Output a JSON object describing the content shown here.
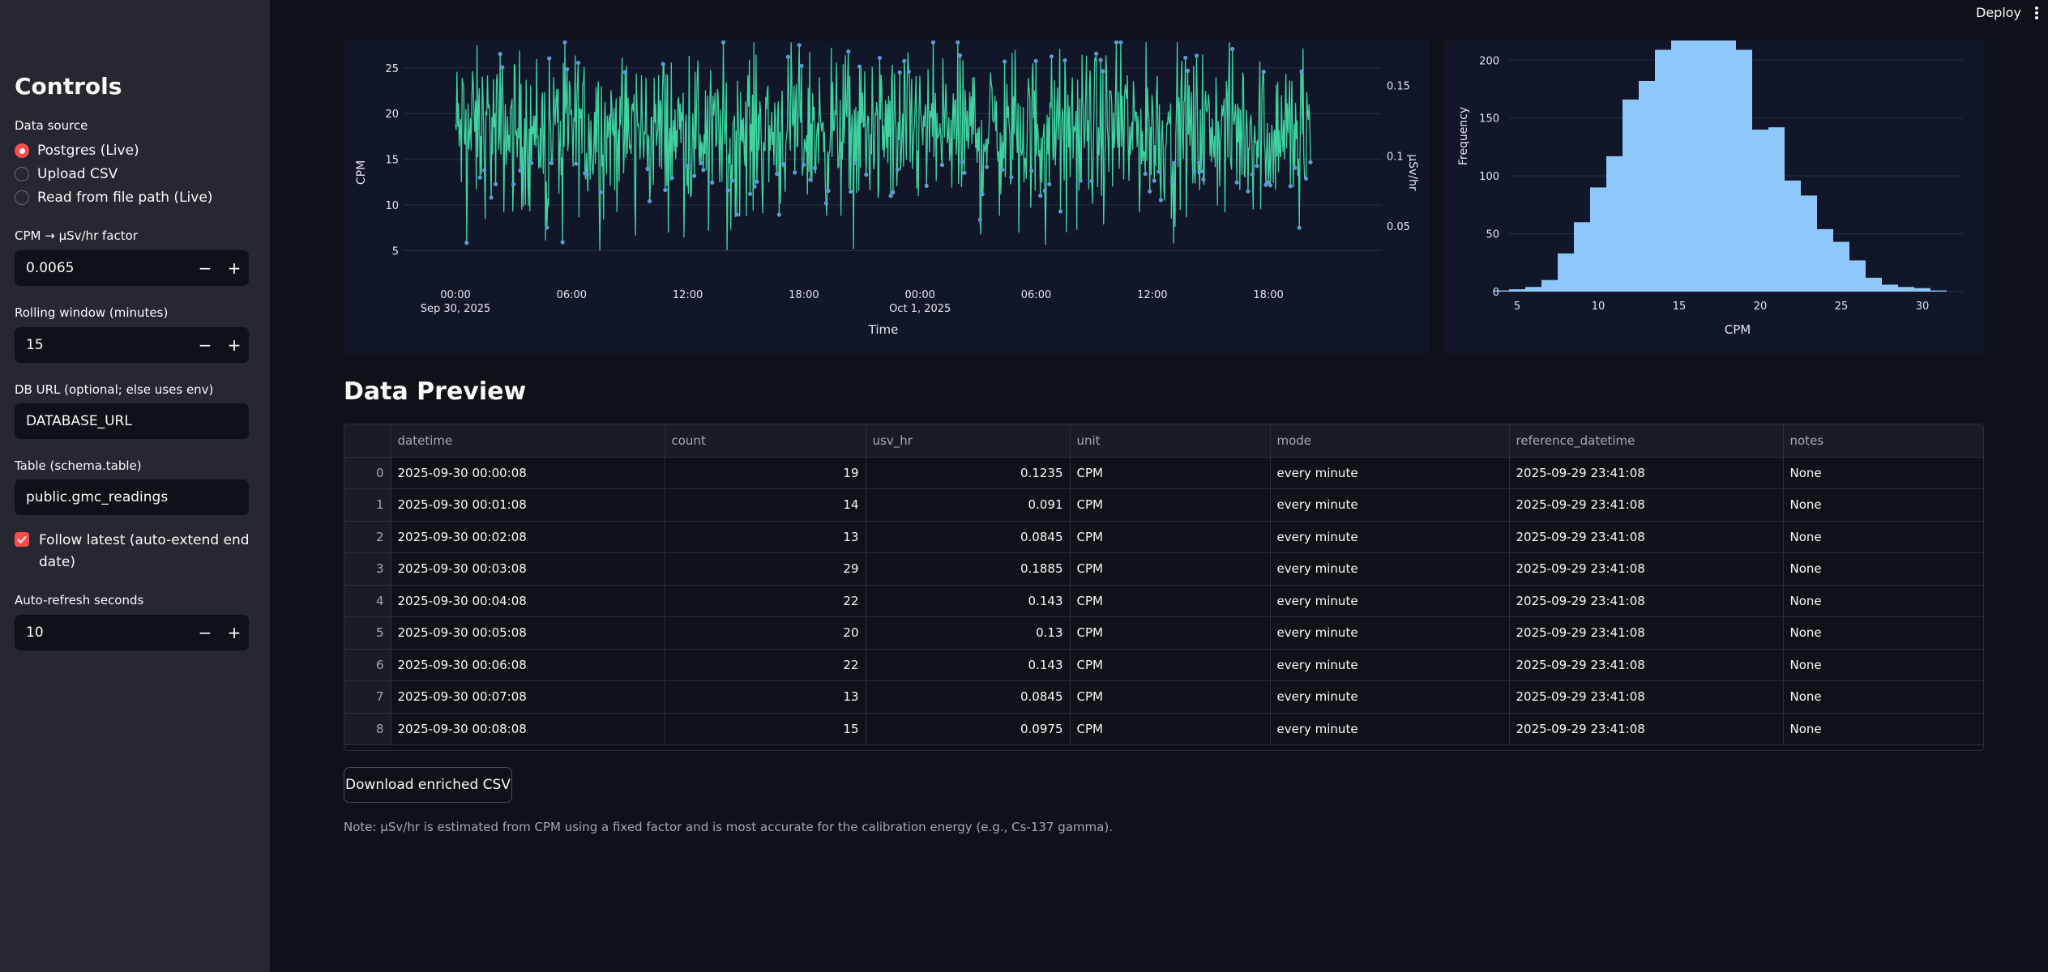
{
  "topbar": {
    "deploy_label": "Deploy"
  },
  "sidebar": {
    "title": "Controls",
    "data_source": {
      "label": "Data source",
      "options": [
        "Postgres (Live)",
        "Upload CSV",
        "Read from file path (Live)"
      ],
      "selected": "Postgres (Live)"
    },
    "factor": {
      "label": "CPM → µSv/hr factor",
      "value": "0.0065"
    },
    "rolling": {
      "label": "Rolling window (minutes)",
      "value": "15"
    },
    "db_url": {
      "label": "DB URL (optional; else uses env)",
      "value": "DATABASE_URL"
    },
    "table": {
      "label": "Table (schema.table)",
      "value": "public.gmc_readings"
    },
    "follow_latest": {
      "label": "Follow latest (auto-extend end date)",
      "checked": true
    },
    "refresh": {
      "label": "Auto-refresh seconds",
      "value": "10"
    },
    "stepper": {
      "minus": "−",
      "plus": "+"
    }
  },
  "chart_data": [
    {
      "type": "line",
      "xlabel": "Time",
      "ylabel": "CPM",
      "y2label": "µSv/hr",
      "ylim": [
        3,
        28
      ],
      "yticks": [
        5,
        10,
        15,
        20,
        25
      ],
      "y2ticks": [
        "0.05",
        "0.1",
        "0.15"
      ],
      "xticks": [
        {
          "label": "00:00",
          "sub": "Sep 30, 2025"
        },
        {
          "label": "06:00",
          "sub": ""
        },
        {
          "label": "12:00",
          "sub": ""
        },
        {
          "label": "18:00",
          "sub": ""
        },
        {
          "label": "00:00",
          "sub": "Oct 1, 2025"
        },
        {
          "label": "06:00",
          "sub": ""
        },
        {
          "label": "12:00",
          "sub": ""
        },
        {
          "label": "18:00",
          "sub": ""
        }
      ],
      "colors": {
        "line": "#3fd3a0",
        "marker": "#5b9bd5"
      },
      "series_note": "~2700 per-minute CPM readings Sep 30 00:00 to Oct 1 ~20:30, mostly 10–27"
    },
    {
      "type": "bar",
      "xlabel": "CPM",
      "ylabel": "Frequency",
      "xticks": [
        5,
        10,
        15,
        20,
        25,
        30
      ],
      "yticks": [
        0,
        50,
        100,
        150,
        200
      ],
      "ylim": [
        0,
        217
      ],
      "categories": [
        4,
        5,
        6,
        7,
        8,
        9,
        10,
        11,
        12,
        13,
        14,
        15,
        16,
        17,
        18,
        19,
        20,
        21,
        22,
        23,
        24,
        25,
        26,
        27,
        28,
        29,
        30,
        31
      ],
      "values": [
        1,
        2,
        4,
        10,
        33,
        60,
        90,
        117,
        166,
        182,
        209,
        217,
        217,
        217,
        217,
        209,
        140,
        142,
        96,
        83,
        54,
        43,
        27,
        12,
        6,
        4,
        3,
        1
      ],
      "color": "#8ec8fb"
    }
  ],
  "preview": {
    "title": "Data Preview",
    "columns": [
      "",
      "datetime",
      "count",
      "usv_hr",
      "unit",
      "mode",
      "reference_datetime",
      "notes"
    ],
    "rows": [
      [
        "0",
        "2025-09-30 00:00:08",
        "19",
        "0.1235",
        "CPM",
        "every minute",
        "2025-09-29 23:41:08",
        "None"
      ],
      [
        "1",
        "2025-09-30 00:01:08",
        "14",
        "0.091",
        "CPM",
        "every minute",
        "2025-09-29 23:41:08",
        "None"
      ],
      [
        "2",
        "2025-09-30 00:02:08",
        "13",
        "0.0845",
        "CPM",
        "every minute",
        "2025-09-29 23:41:08",
        "None"
      ],
      [
        "3",
        "2025-09-30 00:03:08",
        "29",
        "0.1885",
        "CPM",
        "every minute",
        "2025-09-29 23:41:08",
        "None"
      ],
      [
        "4",
        "2025-09-30 00:04:08",
        "22",
        "0.143",
        "CPM",
        "every minute",
        "2025-09-29 23:41:08",
        "None"
      ],
      [
        "5",
        "2025-09-30 00:05:08",
        "20",
        "0.13",
        "CPM",
        "every minute",
        "2025-09-29 23:41:08",
        "None"
      ],
      [
        "6",
        "2025-09-30 00:06:08",
        "22",
        "0.143",
        "CPM",
        "every minute",
        "2025-09-29 23:41:08",
        "None"
      ],
      [
        "7",
        "2025-09-30 00:07:08",
        "13",
        "0.0845",
        "CPM",
        "every minute",
        "2025-09-29 23:41:08",
        "None"
      ],
      [
        "8",
        "2025-09-30 00:08:08",
        "15",
        "0.0975",
        "CPM",
        "every minute",
        "2025-09-29 23:41:08",
        "None"
      ]
    ]
  },
  "download_label": "Download enriched CSV",
  "note": "Note: µSv/hr is estimated from CPM using a fixed factor and is most accurate for the calibration energy (e.g., Cs-137 gamma)."
}
